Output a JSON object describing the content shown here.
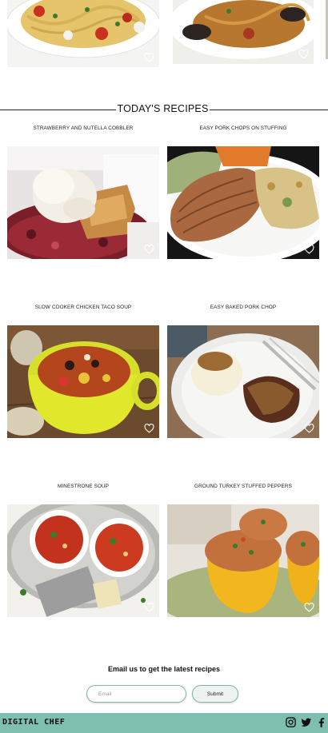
{
  "section": {
    "title": "TODAY'S RECIPES"
  },
  "recipes": [
    {
      "title": "STRAWBERRY AND NUTELLA COBBLER",
      "photo": "cobbler-icecream-photo"
    },
    {
      "title": "EASY PORK CHOPS ON STUFFING",
      "photo": "pork-chop-stuffing-photo"
    },
    {
      "title": "SLOW COOKER CHICKEN TACO SOUP",
      "photo": "taco-soup-photo"
    },
    {
      "title": "EASY BAKED PORK CHOP",
      "photo": "baked-pork-chop-photo"
    },
    {
      "title": "MINESTRONE SOUP",
      "photo": "minestrone-photo"
    },
    {
      "title": "GROUND TURKEY STUFFED PEPPERS",
      "photo": "stuffed-peppers-photo"
    }
  ],
  "newsletter": {
    "title": "Email us to get the latest recipes",
    "placeholder": "Email",
    "submit_label": "Submit"
  },
  "footer": {
    "brand": "DIGITAL CHEF",
    "social_icons": [
      "instagram-icon",
      "twitter-icon",
      "facebook-icon"
    ]
  },
  "colors": {
    "footer_bg": "#7fbfb0",
    "input_border": "#7fb7a6"
  }
}
